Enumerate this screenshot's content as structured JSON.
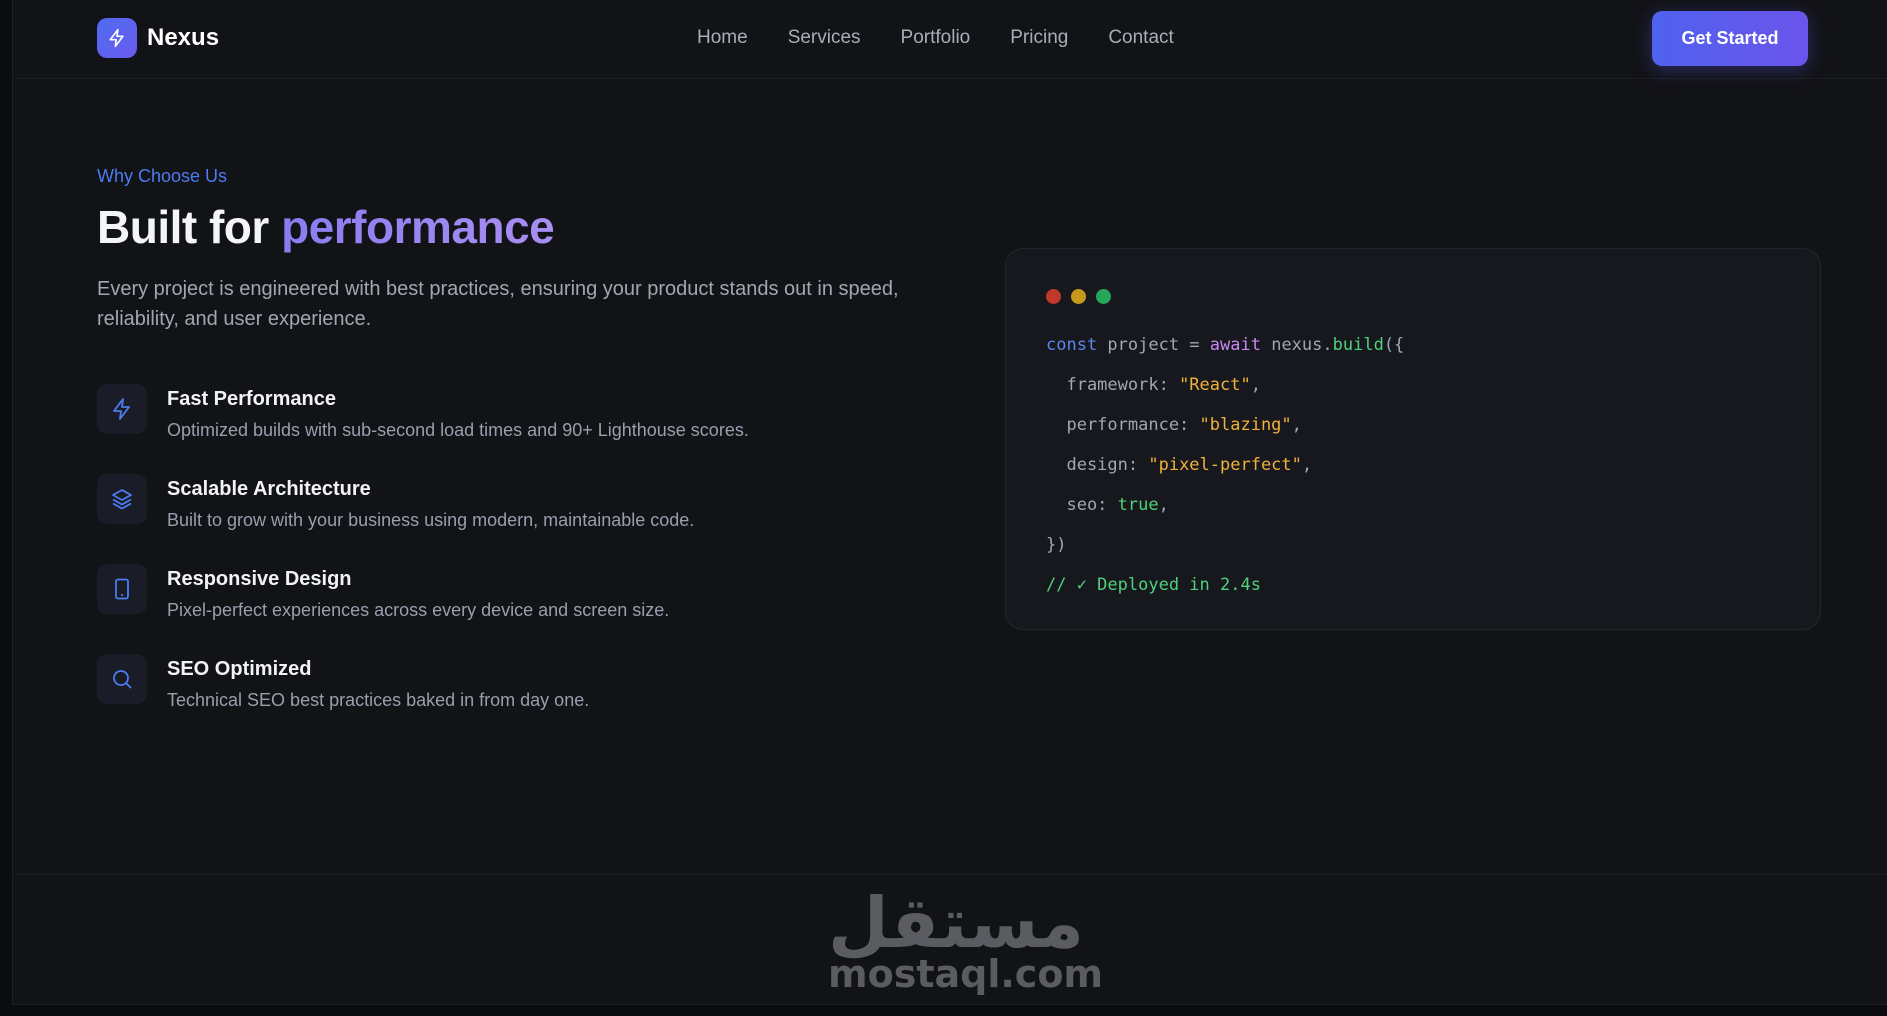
{
  "header": {
    "brand": "Nexus",
    "nav": [
      "Home",
      "Services",
      "Portfolio",
      "Pricing",
      "Contact"
    ],
    "cta_label": "Get Started"
  },
  "hero": {
    "eyebrow": "Why Choose Us",
    "title_plain": "Built for ",
    "title_accent": "performance",
    "lead": "Every project is engineered with best practices, ensuring your product stands out in speed, reliability, and user experience."
  },
  "features": [
    {
      "icon": "bolt-icon",
      "title": "Fast Performance",
      "desc": "Optimized builds with sub-second load times and 90+ Lighthouse scores."
    },
    {
      "icon": "layers-icon",
      "title": "Scalable Architecture",
      "desc": "Built to grow with your business using modern, maintainable code."
    },
    {
      "icon": "mobile-icon",
      "title": "Responsive Design",
      "desc": "Pixel-perfect experiences across every device and screen size."
    },
    {
      "icon": "search-icon",
      "title": "SEO Optimized",
      "desc": "Technical SEO best practices baked in from day one."
    }
  ],
  "code": {
    "window_dots": [
      "#c0392b",
      "#c59a1a",
      "#27a65a"
    ],
    "kw_const": "const",
    "var_project": " project = ",
    "kw_await": "await",
    "obj_nexus": " nexus.",
    "fn_build": "build",
    "open_paren": "({",
    "key_framework": "  framework: ",
    "val_framework": "\"React\"",
    "key_performance": "  performance: ",
    "val_performance": "\"blazing\"",
    "key_design": "  design: ",
    "val_design": "\"pixel-perfect\"",
    "key_seo": "  seo: ",
    "val_seo": "true",
    "comma": ",",
    "close": "})",
    "comment": "// ✓ Deployed in 2.4s"
  },
  "watermark": {
    "arabic": "مستقل",
    "latin": "mostaql.com"
  },
  "colors": {
    "accent": "#4c7bf2",
    "cta_from": "#4f62ee",
    "cta_to": "#6b55ec",
    "title_accent": "#9b85f1"
  }
}
